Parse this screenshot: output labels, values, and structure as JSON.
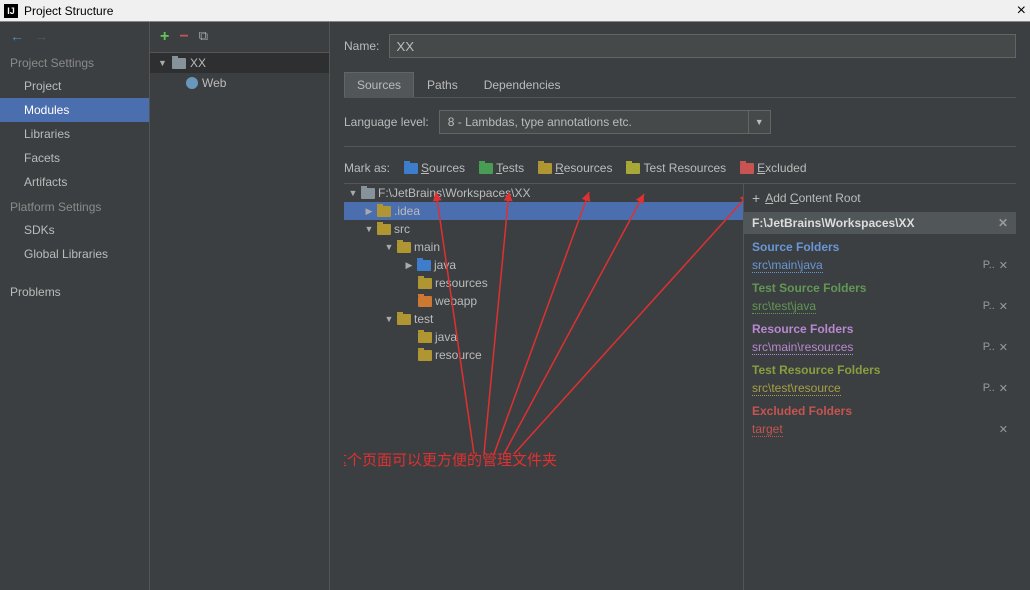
{
  "window": {
    "title": "Project Structure"
  },
  "leftNav": {
    "sectionSettings": "Project Settings",
    "sectionPlatform": "Platform Settings",
    "project": "Project",
    "modules": "Modules",
    "libraries": "Libraries",
    "facets": "Facets",
    "artifacts": "Artifacts",
    "sdks": "SDKs",
    "globalLibs": "Global Libraries",
    "problems": "Problems"
  },
  "moduleTree": {
    "root": "XX",
    "facet": "Web"
  },
  "main": {
    "nameLabel": "Name:",
    "nameValue": "XX",
    "tabs": {
      "sources": "Sources",
      "paths": "Paths",
      "deps": "Dependencies"
    },
    "langLabel": "Language level:",
    "langValue": "8 - Lambdas, type annotations etc.",
    "markLabel": "Mark as:",
    "marks": {
      "sources": "Sources",
      "tests": "Tests",
      "resources": "Resources",
      "testRes": "Test Resources",
      "excluded": "Excluded"
    },
    "tree": {
      "root": "F:\\JetBrains\\Workspaces\\XX",
      "idea": ".idea",
      "src": "src",
      "mainDir": "main",
      "java": "java",
      "resources": "resources",
      "webapp": "webapp",
      "testDir": "test",
      "tjava": "java",
      "tresource": "resource"
    },
    "roots": {
      "addContent": "Add Content Root",
      "path": "F:\\JetBrains\\Workspaces\\XX",
      "sourceH": "Source Folders",
      "sourceP": "src\\main\\java",
      "testSrcH": "Test Source Folders",
      "testSrcP": "src\\test\\java",
      "resH": "Resource Folders",
      "resP": "src\\main\\resources",
      "testResH": "Test Resource Folders",
      "testResP": "src\\test\\resource",
      "exclH": "Excluded Folders",
      "exclP": "target"
    },
    "annotation": "这个页面可以更方便的管理文件夹"
  }
}
